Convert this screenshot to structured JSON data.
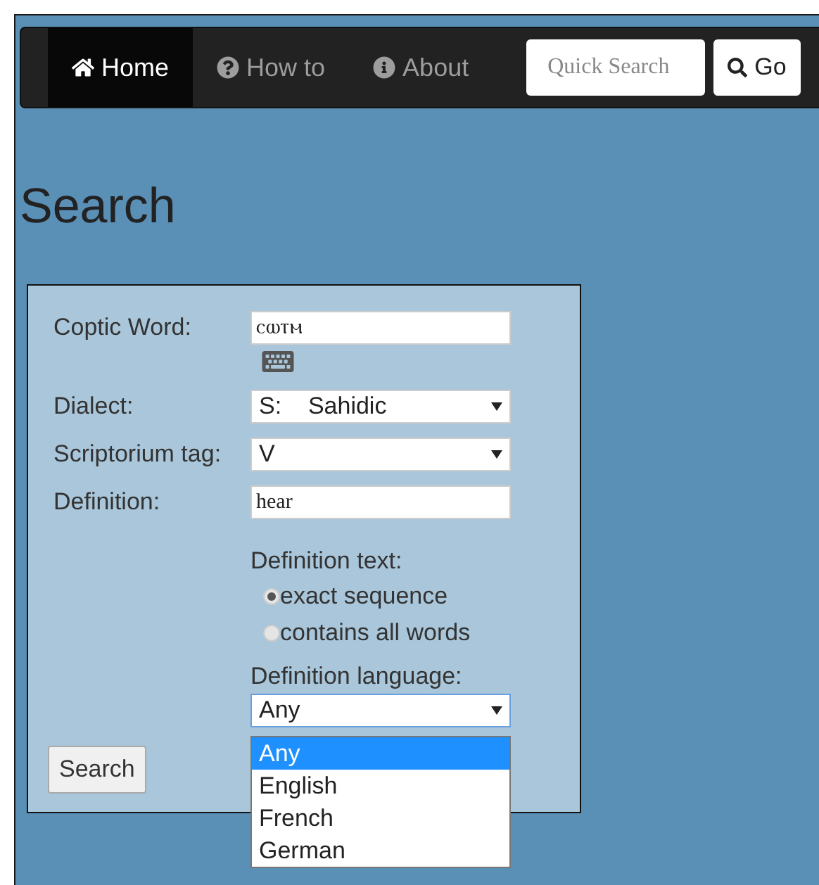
{
  "navbar": {
    "items": [
      {
        "label": "Home",
        "selected": true
      },
      {
        "label": "How to",
        "selected": false
      },
      {
        "label": "About",
        "selected": false
      }
    ],
    "quick_search": {
      "placeholder": "Quick Search"
    },
    "go_button": "Go"
  },
  "title": "Search",
  "form": {
    "fields": [
      {
        "label": "Coptic Word:",
        "kind": "text",
        "value": "ⲥⲱⲧⲙ",
        "keyboard": true
      },
      {
        "label": "Dialect:",
        "kind": "select",
        "value": "S:    Sahidic"
      },
      {
        "label": "Scriptorium tag:",
        "kind": "select",
        "value": "V"
      },
      {
        "label": "Definition:",
        "kind": "text",
        "value": "hear"
      }
    ],
    "definition_text": {
      "label": "Definition text:",
      "options": [
        {
          "label": "exact sequence",
          "selected": true
        },
        {
          "label": "contains all words",
          "selected": false
        }
      ]
    },
    "definition_language": {
      "label": "Definition language:",
      "value": "Any",
      "options": [
        {
          "label": "Any",
          "selected": true
        },
        {
          "label": "English",
          "selected": false
        },
        {
          "label": "French",
          "selected": false
        },
        {
          "label": "German",
          "selected": false
        }
      ]
    },
    "search_button": "Search"
  }
}
